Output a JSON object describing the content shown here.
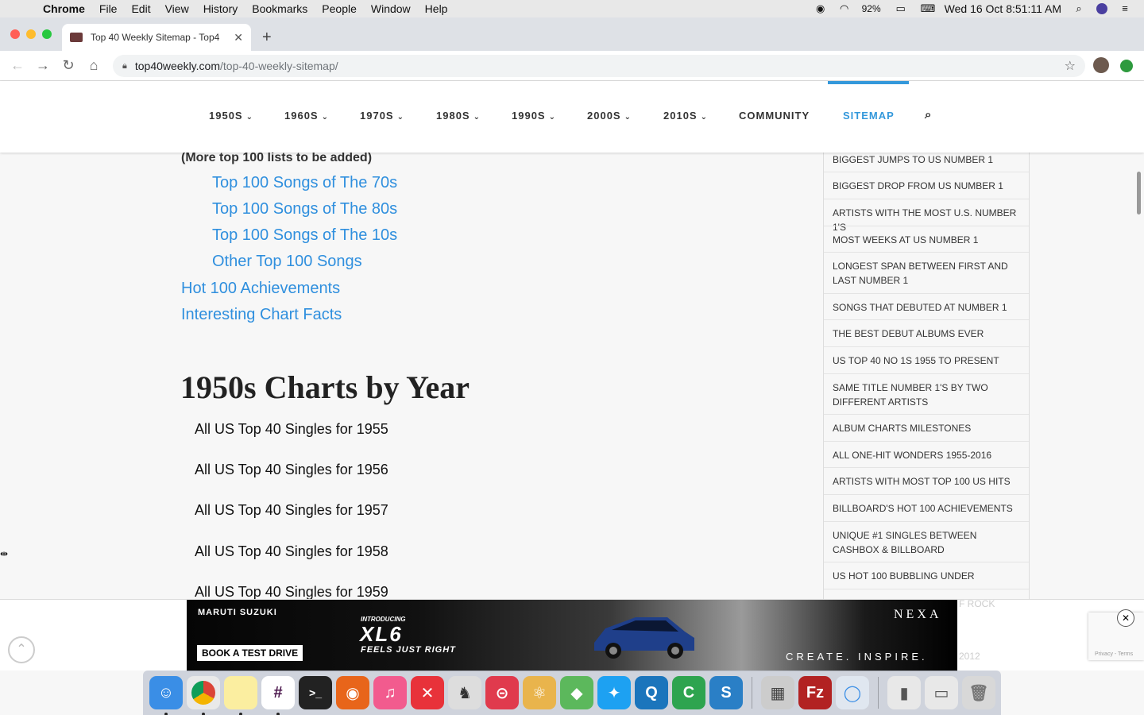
{
  "menubar": {
    "app": "Chrome",
    "items": [
      "File",
      "Edit",
      "View",
      "History",
      "Bookmarks",
      "People",
      "Window",
      "Help"
    ],
    "battery": "92%",
    "clock": "Wed 16 Oct  8:51:11 AM"
  },
  "browser": {
    "tab_title": "Top 40 Weekly Sitemap - Top4",
    "url_host": "top40weekly.com",
    "url_path": "/top-40-weekly-sitemap/"
  },
  "site_nav": {
    "items": [
      "1950S",
      "1960S",
      "1970S",
      "1980S",
      "1990S",
      "2000S",
      "2010S",
      "COMMUNITY",
      "SITEMAP"
    ],
    "active": "SITEMAP"
  },
  "main": {
    "more_note": "(More top 100 lists to be added)",
    "top100_links": [
      "Top 100 Songs of The 70s",
      "Top 100 Songs of The 80s",
      "Top 100 Songs of The 10s",
      "Other Top 100 Songs"
    ],
    "section_links": [
      "Hot 100 Achievements",
      "Interesting Chart Facts"
    ],
    "section_title": "1950s Charts by Year",
    "year_items": [
      "All US Top 40 Singles for 1955",
      "All US Top 40 Singles for 1956",
      "All US Top 40 Singles for 1957",
      "All US Top 40 Singles for 1958",
      "All US Top 40 Singles for 1959"
    ]
  },
  "sidebar": {
    "items": [
      "BIGGEST JUMPS TO US NUMBER 1",
      "BIGGEST DROP FROM US NUMBER 1",
      "ARTISTS WITH THE MOST U.S. NUMBER 1'S",
      "MOST WEEKS AT US NUMBER 1",
      "LONGEST SPAN BETWEEN FIRST AND LAST NUMBER 1",
      "SONGS THAT DEBUTED AT NUMBER 1",
      "THE BEST DEBUT ALBUMS EVER",
      "US TOP 40 NO 1S 1955 TO PRESENT",
      "SAME TITLE NUMBER 1'S BY TWO DIFFERENT ARTISTS",
      "ALBUM CHARTS MILESTONES",
      "ALL ONE-HIT WONDERS 1955-2016",
      "ARTISTS WITH MOST TOP 100 US HITS",
      "BILLBOARD'S HOT 100 ACHIEVEMENTS",
      "UNIQUE #1 SINGLES BETWEEN CASHBOX & BILLBOARD",
      "US HOT 100 BUBBLING UNDER"
    ],
    "faded_1": "F ROCK",
    "faded_2": "2012"
  },
  "ad": {
    "brand": "MARUTI SUZUKI",
    "cta": "BOOK A TEST DRIVE",
    "intro": "INTRODUCING",
    "model": "XL6",
    "tagline": "FEELS JUST RIGHT",
    "nexa": "NEXA",
    "slogan": "CREATE. INSPIRE.",
    "recaptcha": "Privacy - Terms"
  },
  "colors": {
    "link": "#2f8fde",
    "active_nav": "#3498db"
  }
}
